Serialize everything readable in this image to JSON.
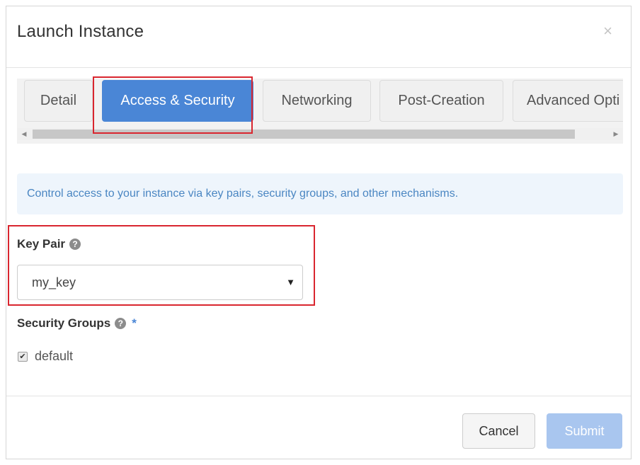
{
  "modal": {
    "title": "Launch Instance",
    "close_glyph": "×"
  },
  "tabs": [
    {
      "label": "Detail",
      "active": false
    },
    {
      "label": "Access & Security",
      "active": true
    },
    {
      "label": "Networking",
      "active": false
    },
    {
      "label": "Post-Creation",
      "active": false
    },
    {
      "label": "Advanced Opti",
      "active": false
    }
  ],
  "scrollbar": {
    "left_arrow": "◀",
    "right_arrow": "▶"
  },
  "info": {
    "text": "Control access to your instance via key pairs, security groups, and other mechanisms."
  },
  "key_pair": {
    "label": "Key Pair",
    "help": "?",
    "selected": "my_key",
    "caret": "▼"
  },
  "security_groups": {
    "label": "Security Groups",
    "help": "?",
    "required": "*",
    "options": [
      {
        "label": "default",
        "checked": true,
        "check_glyph": "✔"
      }
    ]
  },
  "footer": {
    "cancel_label": "Cancel",
    "submit_label": "Submit"
  },
  "colors": {
    "accent": "#4a86d6",
    "highlight_box": "#d9262f",
    "info_text": "#4a86c2",
    "info_bg": "#eef5fc",
    "submit_disabled": "#a9c6ef"
  }
}
